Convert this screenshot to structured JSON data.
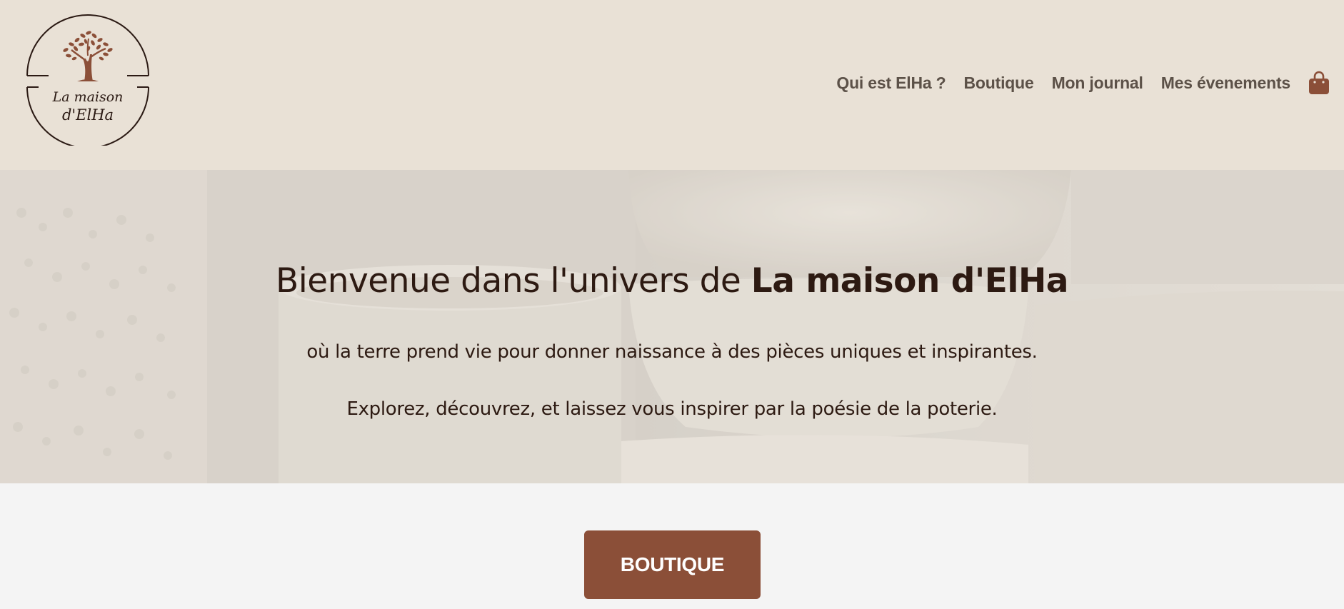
{
  "header": {
    "logo": {
      "text_line1": "La maison",
      "text_line2": "d'ElHa"
    },
    "nav": [
      {
        "label": "Qui est ElHa ?"
      },
      {
        "label": "Boutique"
      },
      {
        "label": "Mon journal"
      },
      {
        "label": "Mes évenements"
      }
    ],
    "cart_icon": "shopping-bag-icon"
  },
  "hero": {
    "title_prefix": "Bienvenue dans l'univers de ",
    "title_brand": "La maison d'ElHa",
    "line1": "où la terre prend vie pour donner naissance à des pièces uniques et inspirantes.",
    "line2": "Explorez, découvrez, et laissez vous inspirer par la poésie de la poterie."
  },
  "cta": {
    "label": "BOUTIQUE"
  },
  "colors": {
    "header_bg": "#e9e1d6",
    "accent": "#8b4f38",
    "nav_text": "#5c5148",
    "hero_text": "#2d1a12",
    "page_bg": "#f4f4f4"
  }
}
